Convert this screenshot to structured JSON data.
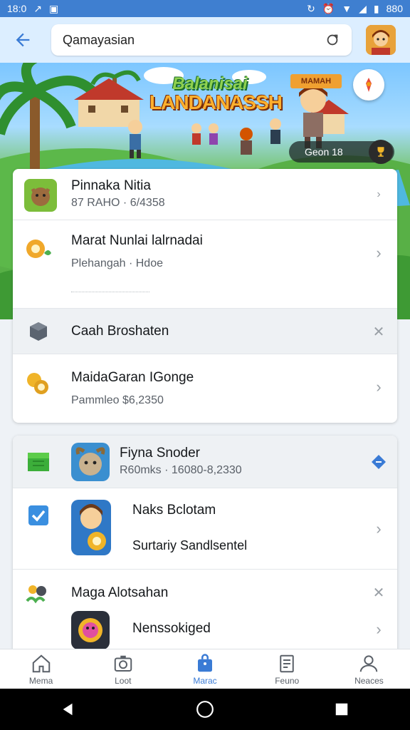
{
  "status_bar": {
    "time": "18:0",
    "battery": "880"
  },
  "search": {
    "value": "Qamayasian"
  },
  "banner": {
    "logo_line1": "Balanisai",
    "logo_line2": "LANDANASSH",
    "tag": "MAMAH",
    "chip_text": "Geon 18"
  },
  "card1": {
    "rows": [
      {
        "title": "Pinnaka Nitia",
        "subtitle": "87 RAHO · 6/4358"
      },
      {
        "title": "Marat Nunlai lalrnadai",
        "subtitle": "Plehangah · Hdoe"
      },
      {
        "title": "Caah Broshaten"
      },
      {
        "title": "MaidaGaran IGonge",
        "subtitle": "Pammleo $6,2350"
      }
    ]
  },
  "card2": {
    "rows": [
      {
        "title": "Fiyna Snoder",
        "subtitle": "R60mks · 16080-8,2330"
      },
      {
        "title": "Naks Bclotam",
        "subtitle": "Surtariy Sandlsentel"
      },
      {
        "title": "Maga Alotsahan",
        "subtitle": "Nenssokiged"
      }
    ]
  },
  "bottom_nav": [
    {
      "label": "Mema",
      "icon": "home-icon"
    },
    {
      "label": "Loot",
      "icon": "camera-icon"
    },
    {
      "label": "Marac",
      "icon": "bag-icon"
    },
    {
      "label": "Feuno",
      "icon": "document-icon"
    },
    {
      "label": "Neaces",
      "icon": "person-icon"
    }
  ],
  "colors": {
    "accent": "#3a7bd5",
    "status_bar": "#3f7fd0",
    "app_bar": "#dceeff"
  }
}
